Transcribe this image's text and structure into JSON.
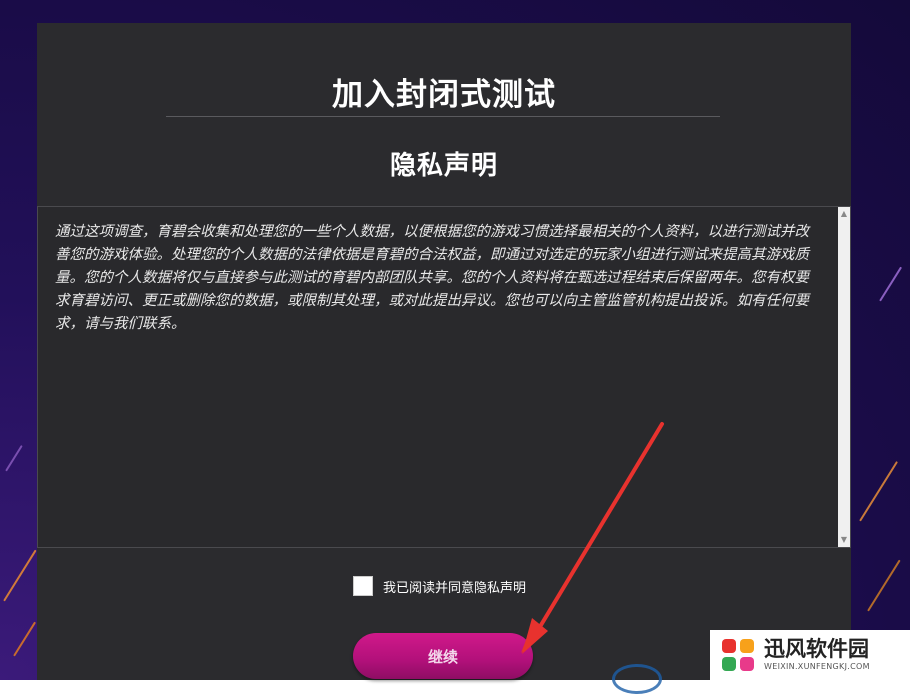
{
  "dialog": {
    "title": "加入封闭式测试",
    "subtitle": "隐私声明",
    "privacy_text": "通过这项调查，育碧会收集和处理您的一些个人数据，以便根据您的游戏习惯选择最相关的个人资料，以进行测试并改善您的游戏体验。处理您的个人数据的法律依据是育碧的合法权益，即通过对选定的玩家小组进行测试来提高其游戏质量。您的个人数据将仅与直接参与此测试的育碧内部团队共享。您的个人资料将在甄选过程结束后保留两年。您有权要求育碧访问、更正或删除您的数据，或限制其处理，或对此提出异议。您也可以向主管监管机构提出投诉。如有任何要求，请与我们联系。",
    "consent_label": "我已阅读并同意隐私声明",
    "consent_checked": false,
    "continue_label": "继续"
  },
  "watermark": {
    "name": "迅风软件园",
    "url": "WEIXIN.XUNFENGKJ.COM"
  },
  "colors": {
    "panel_bg": "#2b2b2e",
    "button_pink": "#c0147f",
    "arrow_red": "#e8322e",
    "page_bg": "#1a0c48"
  }
}
